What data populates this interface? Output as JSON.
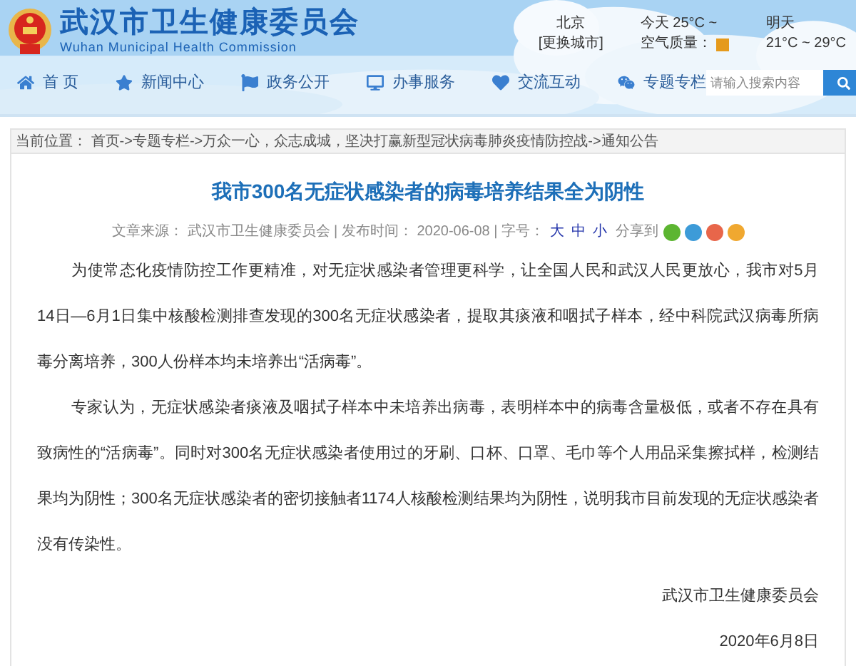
{
  "header": {
    "title": "武汉市卫生健康委员会",
    "subtitle": "Wuhan Municipal Health Commission"
  },
  "weather": {
    "city": "北京",
    "change_city": "[更换城市]",
    "today": "今天 25°C ~",
    "air_quality": "空气质量：",
    "tomorrow_label": "明天",
    "tomorrow": "21°C ~ 29°C"
  },
  "nav": [
    {
      "label": "首 页"
    },
    {
      "label": "新闻中心"
    },
    {
      "label": "政务公开"
    },
    {
      "label": "办事服务"
    },
    {
      "label": "交流互动"
    },
    {
      "label": "专题专栏"
    }
  ],
  "search": {
    "placeholder": "请输入搜索内容"
  },
  "breadcrumb": "当前位置： 首页->专题专栏->万众一心，众志成城，坚决打赢新型冠状病毒肺炎疫情防控战->通知公告",
  "article": {
    "title": "我市300名无症状感染者的病毒培养结果全为阴性",
    "source": "文章来源： 武汉市卫生健康委员会 | 发布时间： 2020-06-08 | 字号：",
    "font_sizes": [
      "大",
      "中",
      "小"
    ],
    "share_label": "分享到",
    "share": [
      {
        "color": "#5cb531"
      },
      {
        "color": "#3d9bd8"
      },
      {
        "color": "#e8664a"
      },
      {
        "color": "#f0a830"
      }
    ],
    "paragraphs": [
      "为使常态化疫情防控工作更精准，对无症状感染者管理更科学，让全国人民和武汉人民更放心，我市对5月14日—6月1日集中核酸检测排查发现的300名无症状感染者，提取其痰液和咽拭子样本，经中科院武汉病毒所病毒分离培养，300人份样本均未培养出“活病毒”。",
      "专家认为，无症状感染者痰液及咽拭子样本中未培养出病毒，表明样本中的病毒含量极低，或者不存在具有致病性的“活病毒”。同时对300名无症状感染者使用过的牙刷、口杯、口罩、毛巾等个人用品采集擦拭样，检测结果均为阴性；300名无症状感染者的密切接触者1174人核酸检测结果均为阴性，说明我市目前发现的无症状感染者没有传染性。"
    ],
    "signature": "武汉市卫生健康委员会",
    "date": "2020年6月8日"
  }
}
